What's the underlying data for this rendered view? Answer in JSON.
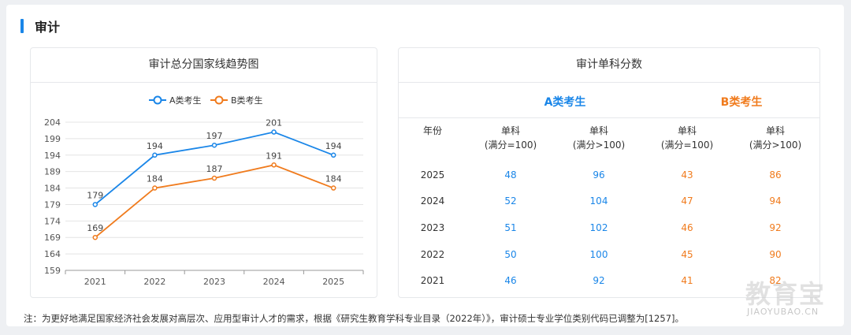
{
  "section": {
    "title": "审计"
  },
  "chart_card": {
    "title": "审计总分国家线趋势图"
  },
  "chart_data": {
    "type": "line",
    "title": "审计总分国家线趋势图",
    "categories": [
      "2021",
      "2022",
      "2023",
      "2024",
      "2025"
    ],
    "series": [
      {
        "name": "A类考生",
        "color": "#1a86e8",
        "values": [
          179,
          194,
          197,
          201,
          194
        ]
      },
      {
        "name": "B类考生",
        "color": "#f07b1d",
        "values": [
          169,
          184,
          187,
          191,
          184
        ]
      }
    ],
    "yticks": [
      159,
      164,
      169,
      174,
      179,
      184,
      189,
      194,
      199,
      204
    ],
    "ylim": [
      159,
      204
    ],
    "grid": true,
    "legend": "top"
  },
  "score_card": {
    "title": "审计单科分数",
    "cat_a": "A类考生",
    "cat_b": "B类考生",
    "headers": {
      "year": "年份",
      "col1_line1": "单科",
      "col1_line2": "(满分=100)",
      "col2_line1": "单科",
      "col2_line2": "(满分>100)",
      "col3_line1": "单科",
      "col3_line2": "(满分=100)",
      "col4_line1": "单科",
      "col4_line2": "(满分>100)"
    },
    "rows": [
      {
        "year": "2025",
        "a1": "48",
        "a2": "96",
        "b1": "43",
        "b2": "86"
      },
      {
        "year": "2024",
        "a1": "52",
        "a2": "104",
        "b1": "47",
        "b2": "94"
      },
      {
        "year": "2023",
        "a1": "51",
        "a2": "102",
        "b1": "46",
        "b2": "92"
      },
      {
        "year": "2022",
        "a1": "50",
        "a2": "100",
        "b1": "45",
        "b2": "90"
      },
      {
        "year": "2021",
        "a1": "46",
        "a2": "92",
        "b1": "41",
        "b2": "82"
      }
    ]
  },
  "note": "注：为更好地满足国家经济社会发展对高层次、应用型审计人才的需求，根据《研究生教育学科专业目录（2022年）》，审计硕士专业学位类别代码已调整为[1257]。",
  "watermark": {
    "main": "教育宝",
    "sub": "JIAOYUBAO.CN"
  }
}
